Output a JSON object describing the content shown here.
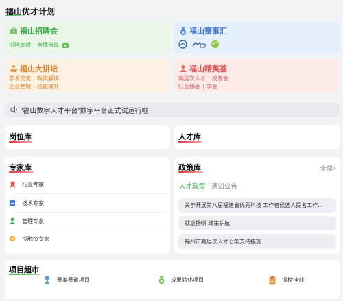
{
  "header": {
    "title": "福山优才计划"
  },
  "cards": {
    "recruit": {
      "title": "福山招聘会",
      "links": [
        "招聘宣讲",
        "直播带岗"
      ],
      "color": "#3aa44a"
    },
    "contest": {
      "title": "福山赛事汇",
      "color": "#3f74c9"
    },
    "lecture": {
      "title": "福山大讲坛",
      "links_row1": [
        "学术交流",
        "政策解读"
      ],
      "links_row2": [
        "企业管理",
        "技能提升"
      ],
      "color": "#d9822b"
    },
    "elite": {
      "title": "福山精英荟",
      "links_row1": [
        "高层次人才",
        "校友会"
      ],
      "links_row2": [
        "行业协会",
        "学会"
      ],
      "color": "#d9534f"
    }
  },
  "notice": {
    "text": "“福山数字人才平台”数字平台正式试运行啦"
  },
  "job_library": {
    "title": "岗位库"
  },
  "talent_library": {
    "title": "人才库"
  },
  "expert_library": {
    "title": "专家库",
    "items": [
      "行业专家",
      "技术专家",
      "管理专家",
      "投融资专家"
    ]
  },
  "policy_library": {
    "title": "政策库",
    "more": "全部>",
    "tabs": [
      "人才政策",
      "通知公告"
    ],
    "items": [
      "关于开展第八届福建省优秀科技 工作者候选人提名工作...",
      "就业扬帆 政策护航",
      "福州市高层次人才七条支持措施"
    ]
  },
  "project_market": {
    "title": "项目超市",
    "items": [
      "赛事赛道项目",
      "成果转化项目",
      "揭榜挂帅"
    ]
  }
}
